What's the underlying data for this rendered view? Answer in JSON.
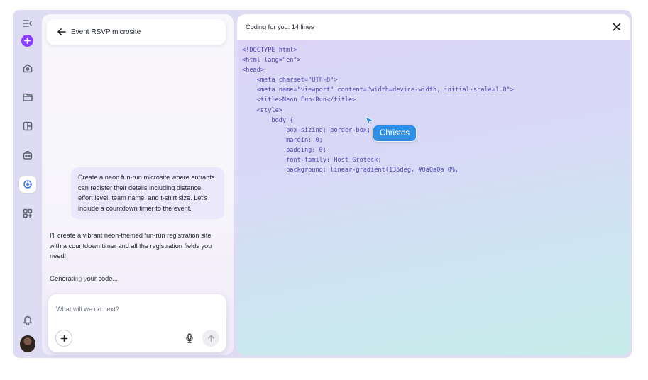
{
  "rail": {
    "icons": [
      "collapse-sidebar-icon",
      "plus-icon",
      "home-icon",
      "folder-icon",
      "templates-icon",
      "brand-icon",
      "ai-code-icon",
      "apps-icon",
      "bell-icon"
    ]
  },
  "chat": {
    "title": "Event RSVP microsite",
    "user_message": "Create a neon fun-run microsite where entrants can register their details including distance, effort level, team name, and t-shirt size. Let's include a countdown timer to the event.",
    "assistant_message": "I'll create a vibrant neon-themed fun-run registration site with a countdown timer and all the registration fields you need!",
    "generating_prefix": "Generati",
    "generating_faded": "ng y",
    "generating_suffix": "our code...",
    "input_placeholder": "What will we do next?"
  },
  "code_panel": {
    "title": "Coding for you: 14 lines",
    "lines": [
      "<!DOCTYPE html>",
      "<html lang=\"en\">",
      "<head>",
      "    <meta charset=\"UTF-8\">",
      "    <meta name=\"viewport\" content=\"width=device-width, initial-scale=1.0\">",
      "    <title>Neon Fun-Run</title>",
      "    <style>",
      "        body {",
      "            box-sizing: border-box;",
      "            margin: 0;",
      "            padding: 0;",
      "            font-family: Host Grotesk;",
      "            background: linear-gradient(135deg, #0a0a0a 0%,"
    ],
    "collaborator_cursor": "Christos"
  },
  "colors": {
    "accent": "#8b3dff",
    "code_text": "#5249b8",
    "cursor_blue": "#2f8ee6"
  }
}
